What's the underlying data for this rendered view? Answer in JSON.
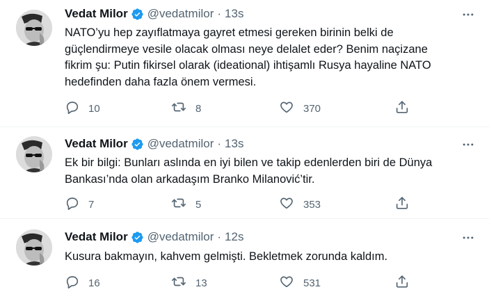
{
  "tweets": [
    {
      "author": "Vedat Milor",
      "handle": "@vedatmilor",
      "separator": "·",
      "time": "13s",
      "text_lines": [
        "NATO’yu hep zayıflatmaya gayret etmesi gereken birinin belki de",
        "güçlendirmeye vesile olacak olması neye delalet eder? Benim naçizane",
        "fikrim şu: Putin fikirsel olarak (ideational) ihtişamlı Rusya hayaline NATO",
        "hedefinden daha fazla önem vermesi."
      ],
      "replies": "10",
      "retweets": "8",
      "likes": "370"
    },
    {
      "author": "Vedat Milor",
      "handle": "@vedatmilor",
      "separator": "·",
      "time": "13s",
      "text_lines": [
        "Ek bir bilgi: Bunları aslında en iyi bilen ve takip edenlerden biri de Dünya",
        "Bankası’nda olan arkadaşım Branko Milanović’tir."
      ],
      "replies": "7",
      "retweets": "5",
      "likes": "353"
    },
    {
      "author": "Vedat Milor",
      "handle": "@vedatmilor",
      "separator": "·",
      "time": "12s",
      "text_lines": [
        "Kusura bakmayın, kahvem gelmişti. Bekletmek zorunda kaldım."
      ],
      "replies": "16",
      "retweets": "13",
      "likes": "531"
    }
  ],
  "icons": {
    "verified": "verified-badge-icon",
    "more": "more-options-icon",
    "reply": "reply-icon",
    "retweet": "retweet-icon",
    "like": "heart-icon",
    "share": "share-icon"
  },
  "colors": {
    "verified": "#1d9bf0",
    "text": "#0f1419",
    "secondary": "#536471",
    "divider": "#eff3f4"
  }
}
